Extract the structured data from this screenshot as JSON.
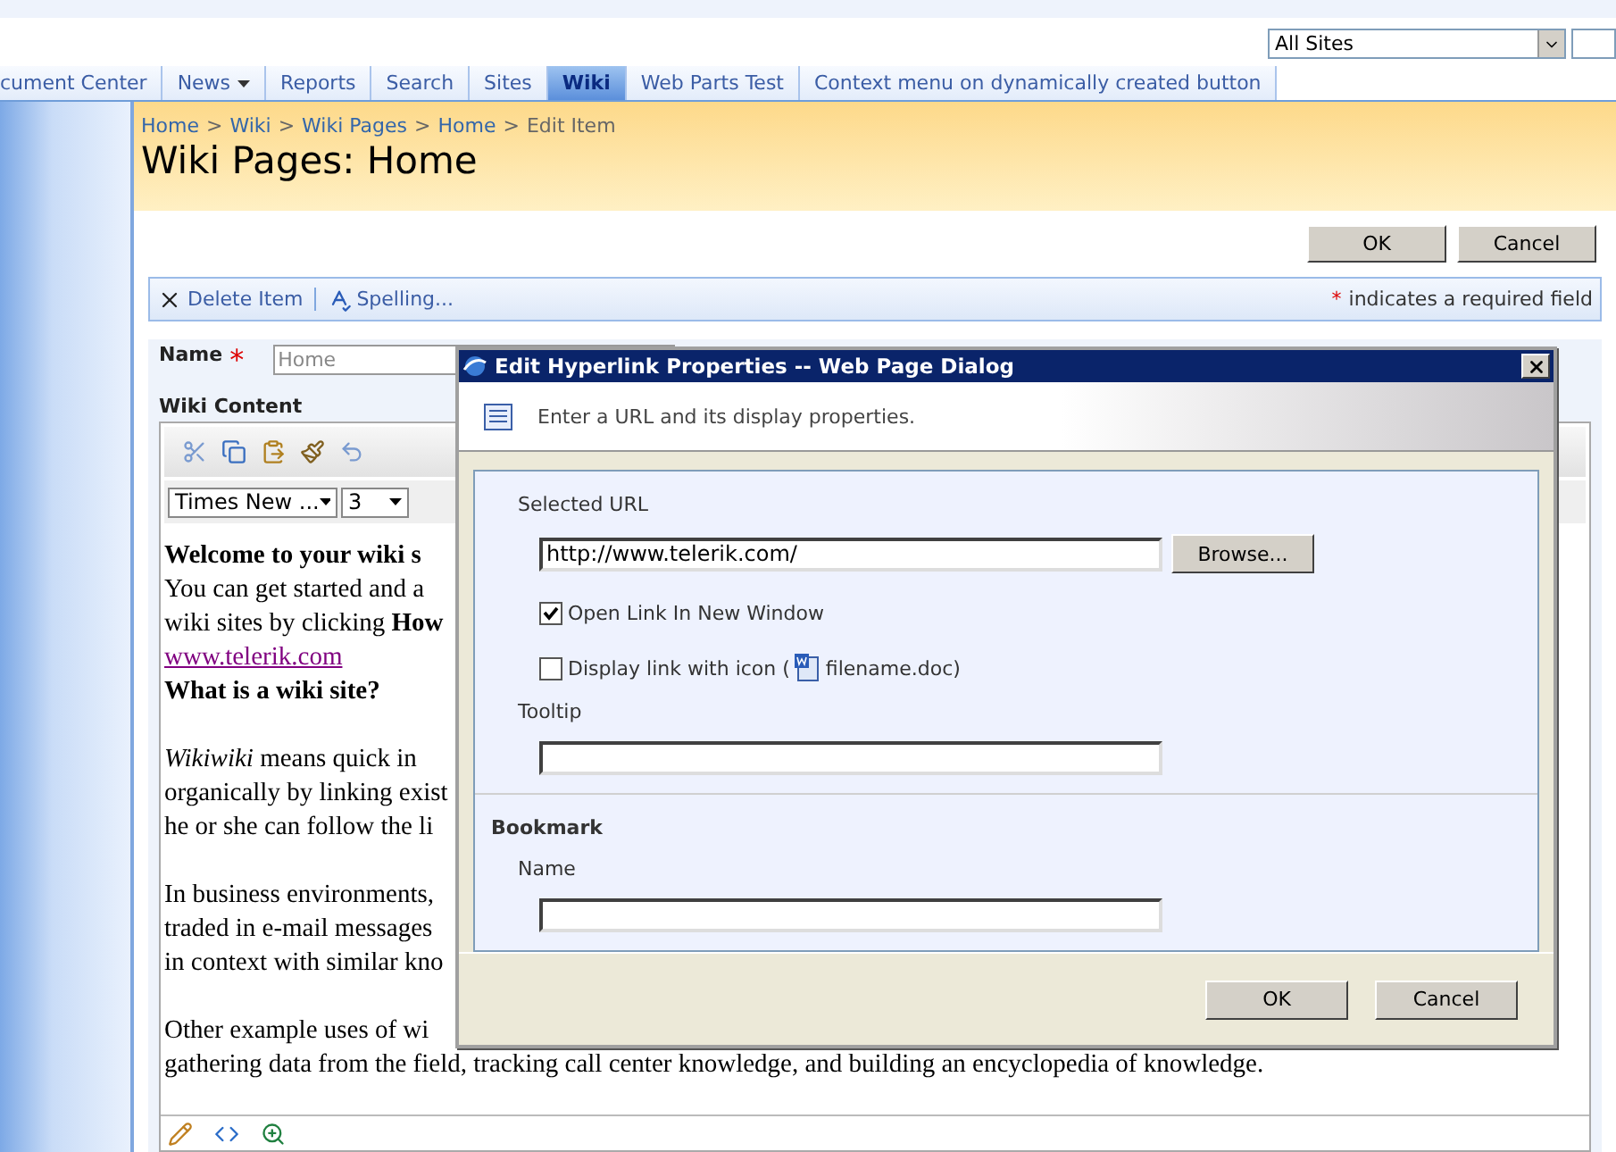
{
  "top_nav": {
    "tabs": [
      {
        "label": "cument Center",
        "selected": false,
        "has_menu": false
      },
      {
        "label": "News",
        "selected": false,
        "has_menu": true
      },
      {
        "label": "Reports",
        "selected": false,
        "has_menu": false
      },
      {
        "label": "Search",
        "selected": false,
        "has_menu": false
      },
      {
        "label": "Sites",
        "selected": false,
        "has_menu": false
      },
      {
        "label": "Wiki",
        "selected": true,
        "has_menu": false
      },
      {
        "label": "Web Parts Test",
        "selected": false,
        "has_menu": false
      },
      {
        "label": "Context menu on dynamically created button",
        "selected": false,
        "has_menu": false
      }
    ],
    "scope_select": "All Sites"
  },
  "breadcrumb": [
    {
      "kind": "link",
      "text": "Home"
    },
    {
      "kind": "sep",
      "text": ">"
    },
    {
      "kind": "link",
      "text": "Wiki"
    },
    {
      "kind": "sep",
      "text": ">"
    },
    {
      "kind": "link",
      "text": "Wiki Pages"
    },
    {
      "kind": "sep",
      "text": ">"
    },
    {
      "kind": "link",
      "text": "Home"
    },
    {
      "kind": "sep",
      "text": ">"
    },
    {
      "kind": "current",
      "text": "Edit Item"
    }
  ],
  "page_title": "Wiki Pages: Home",
  "form_buttons": [
    "OK",
    "Cancel"
  ],
  "toolbar": {
    "items": [
      {
        "kind": "delete",
        "label": "Delete Item"
      },
      {
        "kind": "spelling",
        "label": "Spelling..."
      }
    ],
    "required_mark": "*",
    "required_note": "indicates a required field"
  },
  "name_field": {
    "label": "Name",
    "required_mark": "*",
    "value": "Home"
  },
  "wiki_content": {
    "label": "Wiki Content",
    "font": "Times New ...",
    "size": "3",
    "lines": [
      {
        "kind": "heading",
        "text": "Welcome to your wiki s"
      },
      {
        "kind": "text",
        "text": "You can get started and a"
      },
      {
        "kind": "text",
        "text": "wiki sites by clicking **How**"
      },
      {
        "kind": "link",
        "text": "www.telerik.com"
      },
      {
        "kind": "heading",
        "text": "What is a wiki site?"
      },
      {
        "kind": "blank"
      },
      {
        "kind": "text",
        "text": "*Wikiwiki* means quick in"
      },
      {
        "kind": "text",
        "text": "organically by linking exist"
      },
      {
        "kind": "text",
        "text": "he or she can follow the li"
      },
      {
        "kind": "blank"
      },
      {
        "kind": "text",
        "text": "In business environments,"
      },
      {
        "kind": "text",
        "text": "traded in e-mail messages"
      },
      {
        "kind": "text",
        "text": "in context with similar kno"
      },
      {
        "kind": "blank"
      },
      {
        "kind": "text",
        "text": "Other example uses of wi"
      },
      {
        "kind": "text",
        "text": "gathering data from the field, tracking call center knowledge, and building an encyclopedia of knowledge."
      }
    ]
  },
  "dialog": {
    "title": "Edit Hyperlink Properties -- Web Page Dialog",
    "header_text": "Enter a URL and its display properties.",
    "url_label": "Selected URL",
    "url_value": "http://www.telerik.com/",
    "browse_button": "Browse...",
    "checkboxes": [
      {
        "kind": "plain",
        "label": "Open Link In New Window",
        "checked": true
      },
      {
        "kind": "with_icon",
        "label": "Display link with icon (",
        "label_after": "filename.doc)",
        "checked": false
      }
    ],
    "tooltip_label": "Tooltip",
    "bookmark_heading": "Bookmark",
    "bookmark_name_label": "Name",
    "buttons": [
      "OK",
      "Cancel"
    ]
  }
}
